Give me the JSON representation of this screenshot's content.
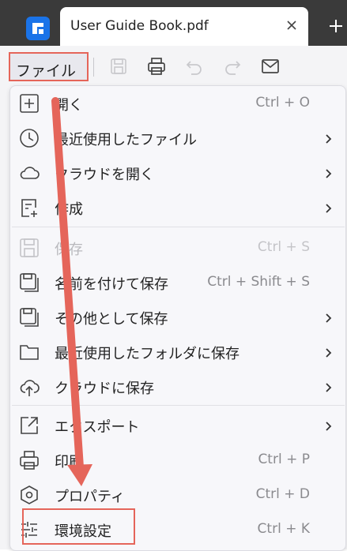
{
  "tab": {
    "title": "User Guide Book.pdf"
  },
  "toolbar": {
    "file_menu_label": "ファイル"
  },
  "menu": {
    "items": [
      {
        "label": "開く",
        "shortcut": "Ctrl + O"
      },
      {
        "label": "最近使用したファイル",
        "shortcut": ""
      },
      {
        "label": "クラウドを開く",
        "shortcut": ""
      },
      {
        "label": "作成",
        "shortcut": ""
      },
      {
        "label": "保存",
        "shortcut": "Ctrl + S"
      },
      {
        "label": "名前を付けて保存",
        "shortcut": "Ctrl + Shift + S"
      },
      {
        "label": "その他として保存",
        "shortcut": ""
      },
      {
        "label": "最近使用したフォルダに保存",
        "shortcut": ""
      },
      {
        "label": "クラウドに保存",
        "shortcut": ""
      },
      {
        "label": "エクスポート",
        "shortcut": ""
      },
      {
        "label": "印刷",
        "shortcut": "Ctrl + P"
      },
      {
        "label": "プロパティ",
        "shortcut": "Ctrl + D"
      },
      {
        "label": "環境設定",
        "shortcut": "Ctrl + K"
      }
    ]
  },
  "colors": {
    "annotation": "#e5655a",
    "logo": "#1a73e8",
    "tab_bar": "#3a3a3a"
  },
  "icons": {
    "logo": "app-logo-icon",
    "tab_close": "close-icon",
    "new_tab": "plus-icon",
    "toolbar": [
      "save-icon",
      "print-icon",
      "undo-icon",
      "redo-icon",
      "mail-icon"
    ]
  }
}
